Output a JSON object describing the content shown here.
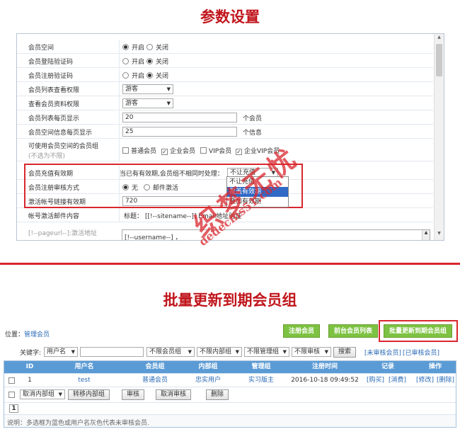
{
  "titles": {
    "top": "参数设置",
    "bottom": "批量更新到期会员组"
  },
  "settings": {
    "member_space": {
      "label": "会员空间",
      "opt_on": "开启",
      "opt_off": "关闭",
      "selected": "on"
    },
    "login_captcha": {
      "label": "会员登陆验证码",
      "opt_on": "开启",
      "opt_off": "关闭",
      "selected": "off"
    },
    "register_captcha": {
      "label": "会员注册验证码",
      "opt_on": "开启",
      "opt_off": "关闭",
      "selected": "off"
    },
    "list_view_perm": {
      "label": "会员列表查看权限",
      "value": "游客"
    },
    "profile_view_perm": {
      "label": "查看会员资料权限",
      "value": "游客"
    },
    "list_page_size": {
      "label": "会员列表每页显示",
      "value": "20",
      "unit": "个会员"
    },
    "space_page_size": {
      "label": "会员空间信息每页显示",
      "value": "25",
      "unit": "个信息"
    },
    "space_groups": {
      "label": "可使用会员空间的会员组",
      "sublabel": "(不选为不限)",
      "options": [
        {
          "label": "普通会员",
          "checked": false
        },
        {
          "label": "企业会员",
          "checked": true
        },
        {
          "label": "VIP会员",
          "checked": false
        },
        {
          "label": "企业VIP会员",
          "checked": true
        }
      ]
    },
    "recharge_valid": {
      "label": "会员充值有效期",
      "hint": "当已有有效期,会员组不相同时处理：",
      "select_value": "不让充值",
      "dropdown": [
        "不让充值",
        "覆盖有效期",
        "叠加有效期"
      ],
      "dropdown_selected": 1
    },
    "register_review": {
      "label": "会员注册审核方式",
      "opt_none": "无",
      "opt_mail": "邮件激活",
      "selected": "none"
    },
    "activation_valid": {
      "label": "激活帐号链接有效期",
      "value": "720"
    },
    "activation_mail": {
      "label": "帐号激活邮件内容",
      "subject_label": "标题：",
      "subject_value": "[[!--sitename--]] Email地址验证"
    },
    "mail_body_label": {
      "label": "[!--pageurl--]:激活地址"
    },
    "mail_body": {
      "value": "[!--username--] ，"
    }
  },
  "member_list": {
    "location_label": "位置：",
    "location_link": "管理会员",
    "buttons": {
      "register": "注册会员",
      "frontend_list": "前台会员列表",
      "batch_update": "批量更新到期会员组"
    },
    "search": {
      "keyword_label": "关键字:",
      "field_select": "用户名",
      "group_select": "不限会员组",
      "inner_group_select": "不限内部组",
      "admin_group_select": "不限管理组",
      "review_select": "不限审核",
      "search_button": "搜索",
      "unreviewed_link": "[未审核会员]",
      "reviewed_link": "[已审核会员]"
    },
    "columns": [
      "ID",
      "用户名",
      "会员组",
      "内部组",
      "管理组",
      "注册时间",
      "记录",
      "操作"
    ],
    "rows": [
      {
        "id": "1",
        "username": "test",
        "group": "普通会员",
        "inner_group": "忠实用户",
        "admin_group": "实习版主",
        "reg_time": "2016-10-18 09:49:52",
        "record_buy": "[购买]",
        "record_consume": "[消费]",
        "op_edit": "[修改]",
        "op_delete": "[删除]"
      }
    ],
    "actions": {
      "cancel_inner_select": "取消内部组",
      "move_inner_button": "转移内部组",
      "review_button": "审核",
      "cancel_review_button": "取消审核",
      "delete_button": "删除"
    },
    "page": "1",
    "note": "说明：多选框为蓝色或用户名灰色代表未审核会员."
  },
  "watermark": {
    "cn": "织梦无忧",
    "url": "dedecms51.com"
  },
  "colors": {
    "title_red": "#c0161c",
    "highlight_red": "#d9272e",
    "green_button": "#7dc242",
    "table_header": "#5b9bd5",
    "link_blue": "#2a6ab5"
  }
}
